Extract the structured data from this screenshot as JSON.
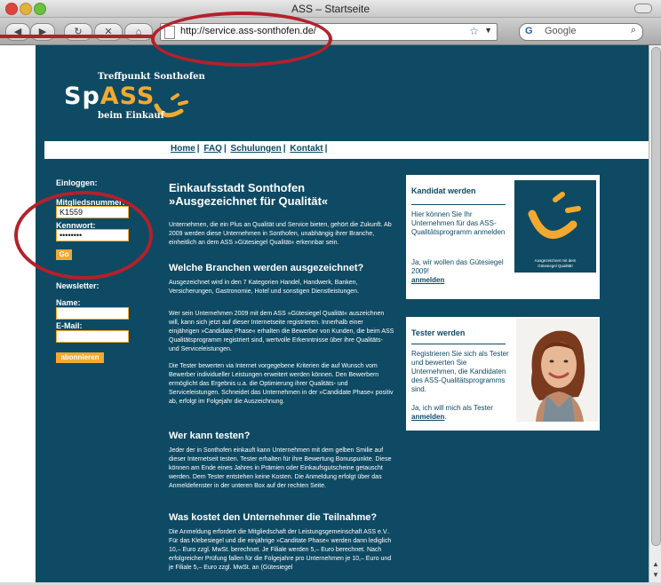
{
  "browser": {
    "window_title": "ASS – Startseite",
    "url": "http://service.ass-sonthofen.de/",
    "search_engine_letter": "G",
    "search_placeholder": "Google",
    "status_text": ""
  },
  "logo": {
    "tagline_top": "Treffpunkt Sonthofen",
    "sp": "Sp",
    "ass": "ASS",
    "tagline_bottom": "beim Einkauf"
  },
  "nav": {
    "items": [
      "Home",
      "FAQ",
      "Schulungen",
      "Kontakt"
    ]
  },
  "login": {
    "heading": "Einloggen:",
    "member_label": "Mitgliedsnummer:",
    "member_value": "K1559",
    "password_label": "Kennwort:",
    "password_value": "••••••••",
    "submit_label": "Go"
  },
  "newsletter": {
    "heading": "Newsletter:",
    "name_label": "Name:",
    "name_value": "",
    "email_label": "E-Mail:",
    "email_value": "",
    "submit_label": "abonnieren"
  },
  "main": {
    "title_line1": "Einkaufsstadt Sonthofen",
    "title_line2": "»Ausgezeichnet für Qualität«",
    "intro": "Unternehmen, die ein Plus an Qualität und Service bieten, gehört die Zukunft. Ab 2009 werden diese Unternehmen in Sonthofen, unabhängig ihrer Branche, einheitlich an dem ASS »Gütesiegel Qualität« erkennbar sein.",
    "section1_title": "Welche Branchen werden ausgezeichnet?",
    "section1_p1": "Ausgezeichnet wird in den 7 Kategorien Handel, Handwerk, Banken, Versicherungen, Gastronomie, Hotel und sonstigen Dienstleistungen.",
    "section1_p2": "Wer sein Unternehmen 2009 mit dem ASS »Gütesiegel Qualität« auszeichnen will, kann sich jetzt auf dieser Internetseite registrieren. Innerhalb einer einjährigen »Candidate Phase« erhalten die Bewerber von Kunden, die beim ASS Qualitätsprogramm registriert sind, wertvolle Erkenntnisse über ihre Qualitäts- und Serviceleistungen.",
    "section1_p3": "Die Tester bewerten via Internet vorgegebene Kriterien die auf Wunsch vom Bewerber individueller Leistungen erweitert werden können. Den Bewerbern ermöglicht das Ergebnis u.a. die Optimierung ihrer Qualitäts- und Serviceleistungen. Schneidet das Unternehmen in der »Candidate Phase« positiv ab, erfolgt im Folgejahr die Auszeichnung.",
    "section2_title": "Wer kann testen?",
    "section2_p1": "Jeder der in Sonthofen einkauft kann Unternehmen mit dem gelben Smilie auf dieser Internetseit testen. Tester erhalten für ihre Bewertung Bonuspunkte. Diese können am Ende eines Jahres in Prämien oder Einkaufsgutscheine getauscht werden. Dem Tester entstehen keine Kosten. Die Anmeldung erfolgt über das Anmeldefenster in der unteren Box auf der rechten Seite.",
    "section3_title": "Was kostet den Unternehmer die Teilnahme?",
    "section3_p1": "Die Anmeldung erfordert die Mitgliedschaft der Leistungsgemeinschaft ASS e.V.. Für das Klebesiegel und die einjährige »Canditate Phase« werden dann lediglich 10,– Euro zzgl. MwSt. berechnet. Je Filiale werden 5,– Euro berechnet. Nach erfolgreicher Prüfung fallen für die Folgejahre pro Unternehmen je 10,– Euro und je Filiale 5,– Euro zzgl. MwSt. an (Gütesiegel"
  },
  "candidate_box": {
    "title": "Kandidat werden",
    "text1": "Hier können Sie Ihr Unternehmen für das ASS-Qualitätsprogramm anmelden",
    "text2": "Ja, wir wollen das Gütesiegel 2009!",
    "link": "anmelden",
    "seal_line1": "Ausgezeichnet mit dem",
    "seal_line2": "Gütesiegel Qualität!"
  },
  "tester_box": {
    "title": "Tester werden",
    "text1": "Registrieren Sie sich als Tester und bewerten Sie Unternehmen, die Kandidaten des ASS-Qualitätsprogramms sind.",
    "text2_prefix": "Ja, ich will mich als Tester",
    "link": "anmelden",
    "text2_suffix": "."
  },
  "colors": {
    "page_bg": "#0e4a63",
    "accent": "#f3a92f",
    "annotation": "#b3212b"
  }
}
